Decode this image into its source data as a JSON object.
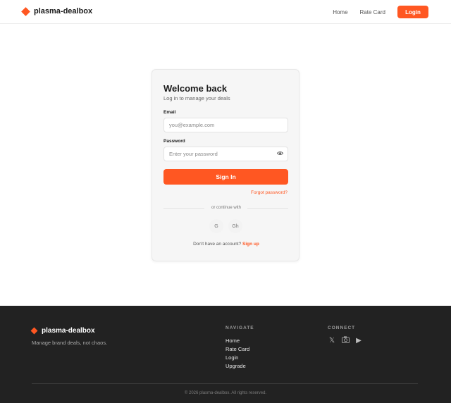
{
  "header": {
    "brand_name": "plasma-dealbox",
    "brand_icon": "diamond-icon",
    "nav": [
      {
        "label": "Home"
      },
      {
        "label": "Rate Card"
      }
    ],
    "login_label": "Login"
  },
  "login_card": {
    "title": "Welcome back",
    "subtitle": "Log in to manage your deals",
    "email": {
      "label": "Email",
      "placeholder": "you@example.com",
      "value": ""
    },
    "password": {
      "label": "Password",
      "placeholder": "Enter your password",
      "value": "",
      "toggle_icon": "eye-icon"
    },
    "submit_label": "Sign In",
    "forgot_label": "Forgot password?",
    "divider_label": "or continue with",
    "social": [
      {
        "label": "G",
        "icon": "google-icon"
      },
      {
        "label": "Gh",
        "icon": "github-icon"
      }
    ],
    "signup_prompt": "Don't have an account?",
    "signup_label": "Sign up"
  },
  "footer": {
    "brand_name": "plasma-dealbox",
    "tagline": "Manage brand deals, not chaos.",
    "navigate_heading": "NAVIGATE",
    "navigate_links": [
      {
        "label": "Home"
      },
      {
        "label": "Rate Card"
      },
      {
        "label": "Login"
      },
      {
        "label": "Upgrade"
      }
    ],
    "connect_heading": "CONNECT",
    "social_icons": [
      {
        "glyph": "𝕏",
        "name": "x-twitter-icon"
      },
      {
        "glyph": "📷",
        "name": "instagram-icon"
      },
      {
        "glyph": "▶",
        "name": "youtube-icon"
      }
    ],
    "copyright": "© 2026 plasma-dealbox. All rights reserved."
  },
  "colors": {
    "accent": "#ff5722",
    "footer_bg": "#222222",
    "card_bg": "#f6f6f6"
  }
}
